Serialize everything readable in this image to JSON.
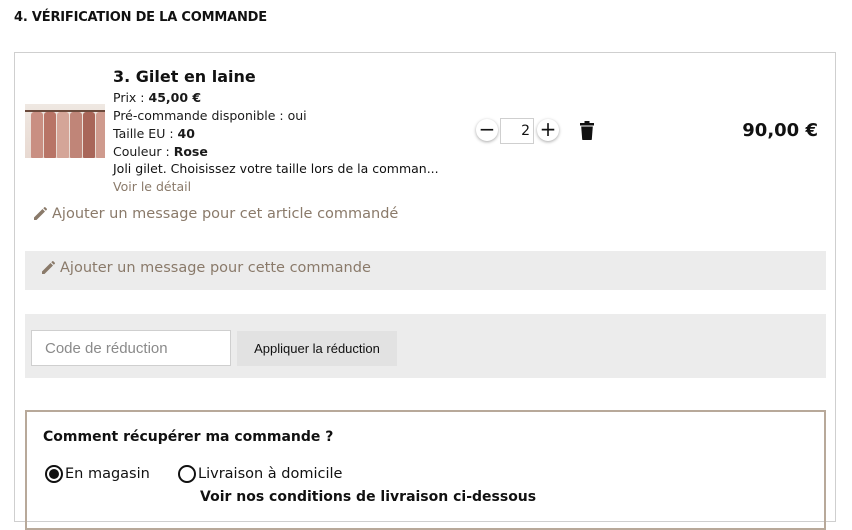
{
  "section": {
    "title": "4. VÉRIFICATION DE LA COMMANDE"
  },
  "item": {
    "image": "knit-cardigans-on-rack",
    "name": "3. Gilet en laine",
    "price_label": "Prix : ",
    "price_value": "45,00 €",
    "preorder": "Pré-commande disponible : oui",
    "size_label": "Taille EU : ",
    "size_value": "40",
    "color_label": "Couleur : ",
    "color_value": "Rose",
    "description": "Joli gilet. Choisissez votre taille lors de la comman...",
    "detail_link": "Voir le détail",
    "quantity": "2",
    "total": "90,00 €",
    "message_link": "Ajouter un message pour cet article commandé"
  },
  "order_message": {
    "link": "Ajouter un message pour cette commande"
  },
  "discount": {
    "placeholder": "Code de réduction",
    "button": "Appliquer la réduction"
  },
  "pickup": {
    "title": "Comment récupérer ma commande ?",
    "options": [
      {
        "label": "En magasin",
        "selected": true
      },
      {
        "label": "Livraison à domicile",
        "selected": false
      }
    ],
    "conditions": "Voir nos conditions de livraison ci-dessous"
  },
  "colors": {
    "accent_link": "#8a7a6a",
    "panel_gray": "#ececec",
    "pickup_border": "#b8a99a"
  },
  "icons": {
    "minus": "minus-icon",
    "plus": "plus-icon",
    "trash": "trash-icon",
    "pencil": "pencil-icon"
  }
}
